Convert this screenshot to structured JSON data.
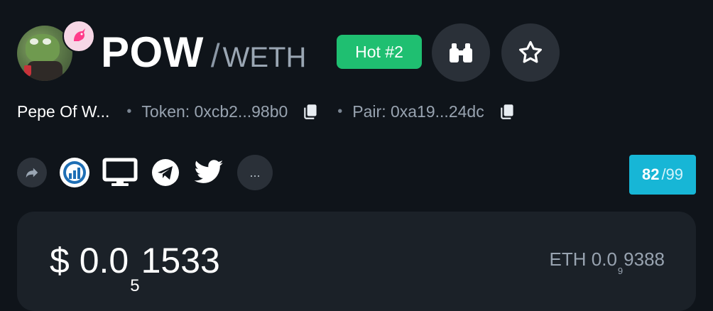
{
  "pair": {
    "symbol": "POW",
    "quote": "WETH",
    "hot_label": "Hot #2",
    "name": "Pepe Of W...",
    "token_label": "Token: 0xcb2...98b0",
    "pair_label": "Pair: 0xa19...24dc"
  },
  "score": {
    "value": "82",
    "max": "/99"
  },
  "price": {
    "prefix": "$ 0.0",
    "zeros": "5",
    "digits": "1533"
  },
  "eth_price": {
    "prefix": "ETH 0.0",
    "zeros": "9",
    "digits": "9388"
  },
  "socials": {
    "more_label": "..."
  },
  "colors": {
    "hot": "#1fbf71",
    "score": "#17b6d6",
    "background": "#0f141a",
    "card": "#1b2128"
  }
}
